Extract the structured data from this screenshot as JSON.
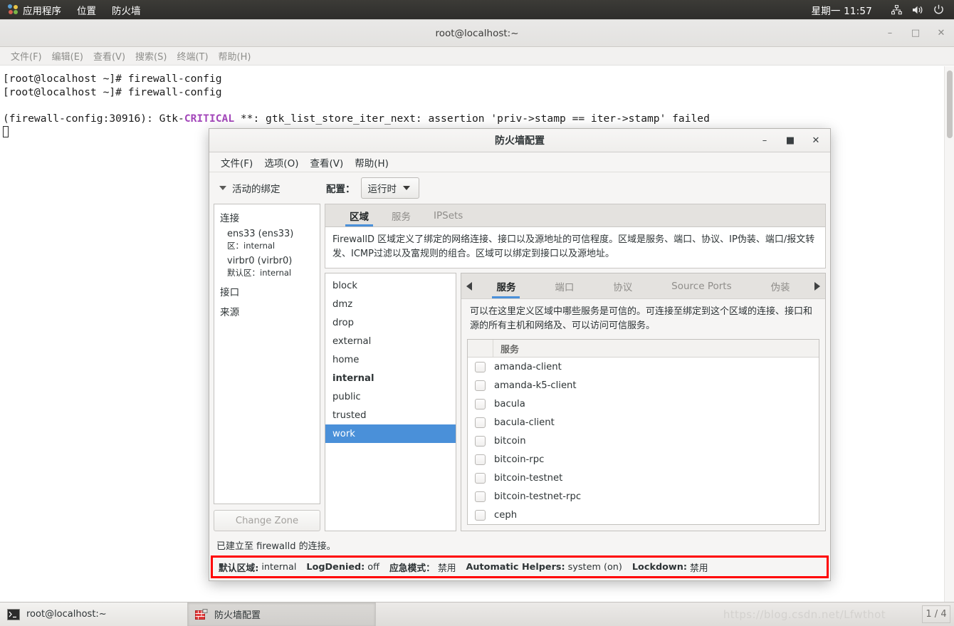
{
  "top_panel": {
    "logo": "gnome-logo",
    "menus": [
      "应用程序",
      "位置",
      "防火墙"
    ],
    "clock": "星期一 11:57",
    "tray_icons": [
      "network-icon",
      "volume-icon",
      "power-icon"
    ]
  },
  "terminal": {
    "title": "root@localhost:~",
    "menus": [
      "文件(F)",
      "编辑(E)",
      "查看(V)",
      "搜索(S)",
      "终端(T)",
      "帮助(H)"
    ],
    "window_buttons": [
      "minimize",
      "maximize",
      "close"
    ],
    "lines": [
      "[root@localhost ~]# firewall-config",
      "[root@localhost ~]# firewall-config",
      ""
    ],
    "warning_prefix": "(firewall-config:30916): Gtk-",
    "warning_level": "CRITICAL",
    "warning_suffix": " **: gtk_list_store_iter_next: assertion 'priv->stamp == iter->stamp' failed"
  },
  "dialog": {
    "title": "防火墙配置",
    "window_buttons": [
      "minimize",
      "maximize",
      "close"
    ],
    "menus": [
      "文件(F)",
      "选项(O)",
      "查看(V)",
      "帮助(H)"
    ],
    "binding_toggle_label": "活动的绑定",
    "config_label": "配置：",
    "config_value": "运行时",
    "left_pane": {
      "connections_title": "连接",
      "connections": [
        {
          "name": "ens33 (ens33)",
          "zone_label": "区：",
          "zone": "internal"
        },
        {
          "name": "virbr0 (virbr0)",
          "zone_label": "默认区：",
          "zone": "internal"
        }
      ],
      "interfaces_title": "接口",
      "sources_title": "来源",
      "change_zone_button": "Change Zone"
    },
    "outer_tabs": [
      {
        "label": "区域",
        "active": true
      },
      {
        "label": "服务",
        "active": false
      },
      {
        "label": "IPSets",
        "active": false
      }
    ],
    "zone_description": "FirewallD 区域定义了绑定的网络连接、接口以及源地址的可信程度。区域是服务、端口、协议、IP伪装、端口/报文转发、ICMP过滤以及富规则的组合。区域可以绑定到接口以及源地址。",
    "zones": [
      {
        "name": "block",
        "bold": false,
        "selected": false
      },
      {
        "name": "dmz",
        "bold": false,
        "selected": false
      },
      {
        "name": "drop",
        "bold": false,
        "selected": false
      },
      {
        "name": "external",
        "bold": false,
        "selected": false
      },
      {
        "name": "home",
        "bold": false,
        "selected": false
      },
      {
        "name": "internal",
        "bold": true,
        "selected": false
      },
      {
        "name": "public",
        "bold": false,
        "selected": false
      },
      {
        "name": "trusted",
        "bold": false,
        "selected": false
      },
      {
        "name": "work",
        "bold": false,
        "selected": true
      }
    ],
    "inner_tabs": [
      {
        "label": "服务",
        "active": true
      },
      {
        "label": "端口",
        "active": false
      },
      {
        "label": "协议",
        "active": false
      },
      {
        "label": "Source Ports",
        "active": false
      },
      {
        "label": "伪装",
        "active": false
      }
    ],
    "inner_tab_scroll_left": "◀",
    "inner_tab_scroll_right": "▶",
    "services_description": "可以在这里定义区域中哪些服务是可信的。可连接至绑定到这个区域的连接、接口和源的所有主机和网络及、可以访问可信服务。",
    "services_column_header": "服务",
    "services": [
      {
        "name": "amanda-client",
        "checked": false
      },
      {
        "name": "amanda-k5-client",
        "checked": false
      },
      {
        "name": "bacula",
        "checked": false
      },
      {
        "name": "bacula-client",
        "checked": false
      },
      {
        "name": "bitcoin",
        "checked": false
      },
      {
        "name": "bitcoin-rpc",
        "checked": false
      },
      {
        "name": "bitcoin-testnet",
        "checked": false
      },
      {
        "name": "bitcoin-testnet-rpc",
        "checked": false
      },
      {
        "name": "ceph",
        "checked": false
      }
    ],
    "connection_status": "已建立至 firewalld 的连接。",
    "status_bar": {
      "highlight_color": "#ff0000",
      "items": [
        {
          "key": "默认区域:",
          "value": "internal"
        },
        {
          "key": "LogDenied:",
          "value": "off"
        },
        {
          "key": "应急模式：",
          "value": "禁用"
        },
        {
          "key": "Automatic Helpers:",
          "value": "system (on)"
        },
        {
          "key": "Lockdown:",
          "value": "禁用"
        }
      ]
    }
  },
  "taskbar": {
    "tasks": [
      {
        "label": "root@localhost:~",
        "icon": "terminal-icon",
        "active": false
      },
      {
        "label": "防火墙配置",
        "icon": "firewall-icon",
        "active": true
      }
    ],
    "watermark": "https://blog.csdn.net/Lfwthot",
    "workspace": "1 / 4"
  },
  "colors": {
    "accent": "#4a90d9",
    "selection": "#4a90d9",
    "alert": "#ff0000",
    "panel_bg": "#2e2d2b"
  }
}
